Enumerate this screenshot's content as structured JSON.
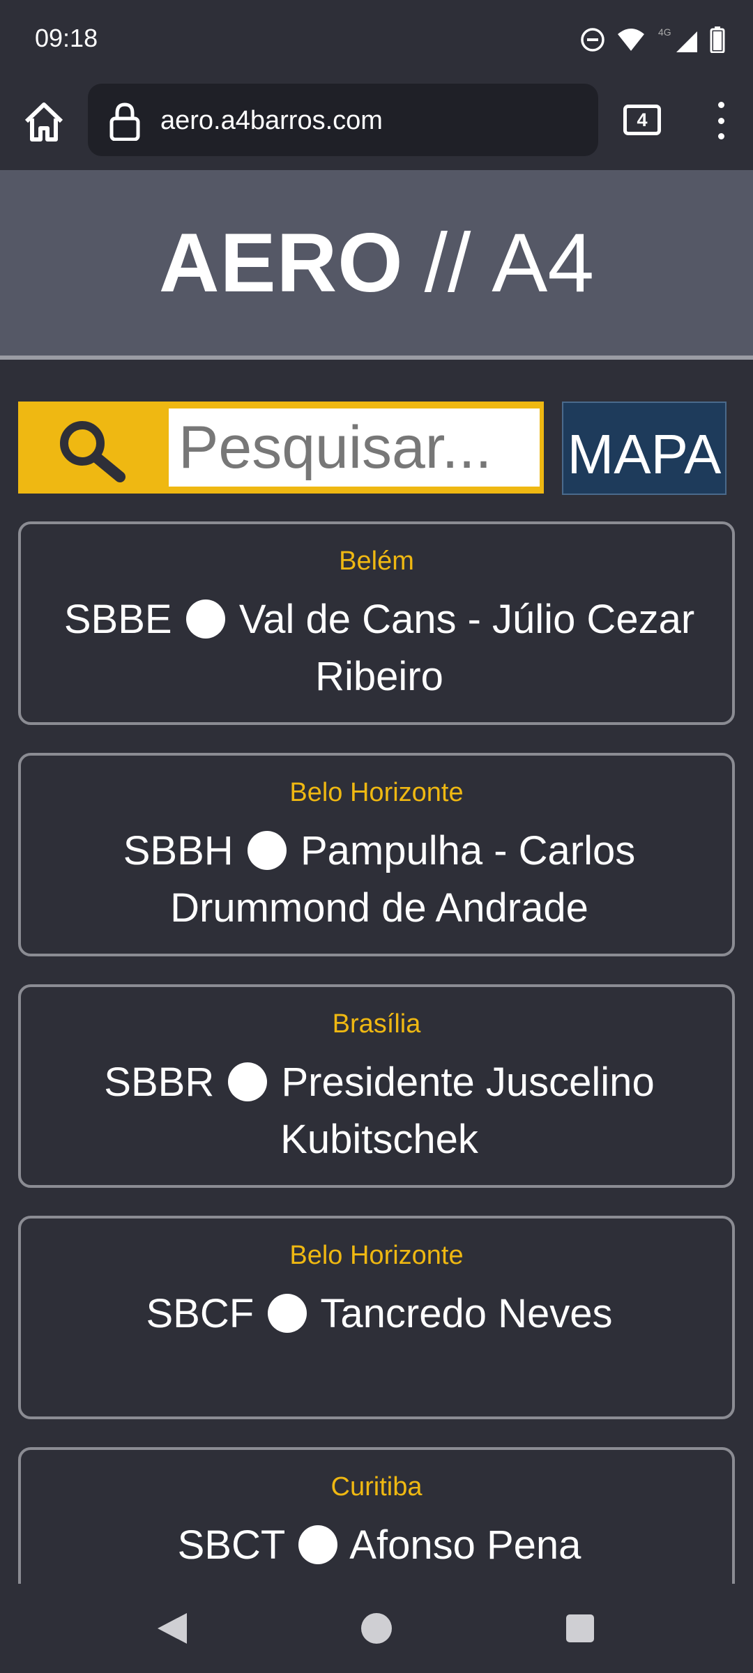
{
  "status": {
    "time": "09:18",
    "network": "4G"
  },
  "browser": {
    "url": "aero.a4barros.com",
    "tab_count": "4"
  },
  "header": {
    "brand_bold": "AERO",
    "brand_sep": "//",
    "brand_thin": "A4"
  },
  "search": {
    "placeholder": "Pesquisar..."
  },
  "map_button": {
    "label": "MAPA"
  },
  "airports": [
    {
      "city": "Belém",
      "code": "SBBE",
      "name": "Val de Cans - Júlio Cezar Ribeiro"
    },
    {
      "city": "Belo Horizonte",
      "code": "SBBH",
      "name": "Pampulha - Carlos Drummond de Andrade"
    },
    {
      "city": "Brasília",
      "code": "SBBR",
      "name": "Presidente Juscelino Kubitschek"
    },
    {
      "city": "Belo Horizonte",
      "code": "SBCF",
      "name": "Tancredo Neves"
    },
    {
      "city": "Curitiba",
      "code": "SBCT",
      "name": "Afonso Pena"
    }
  ],
  "colors": {
    "accent": "#efb812",
    "background": "#2e2f38",
    "map_button": "#1e3b5b"
  }
}
